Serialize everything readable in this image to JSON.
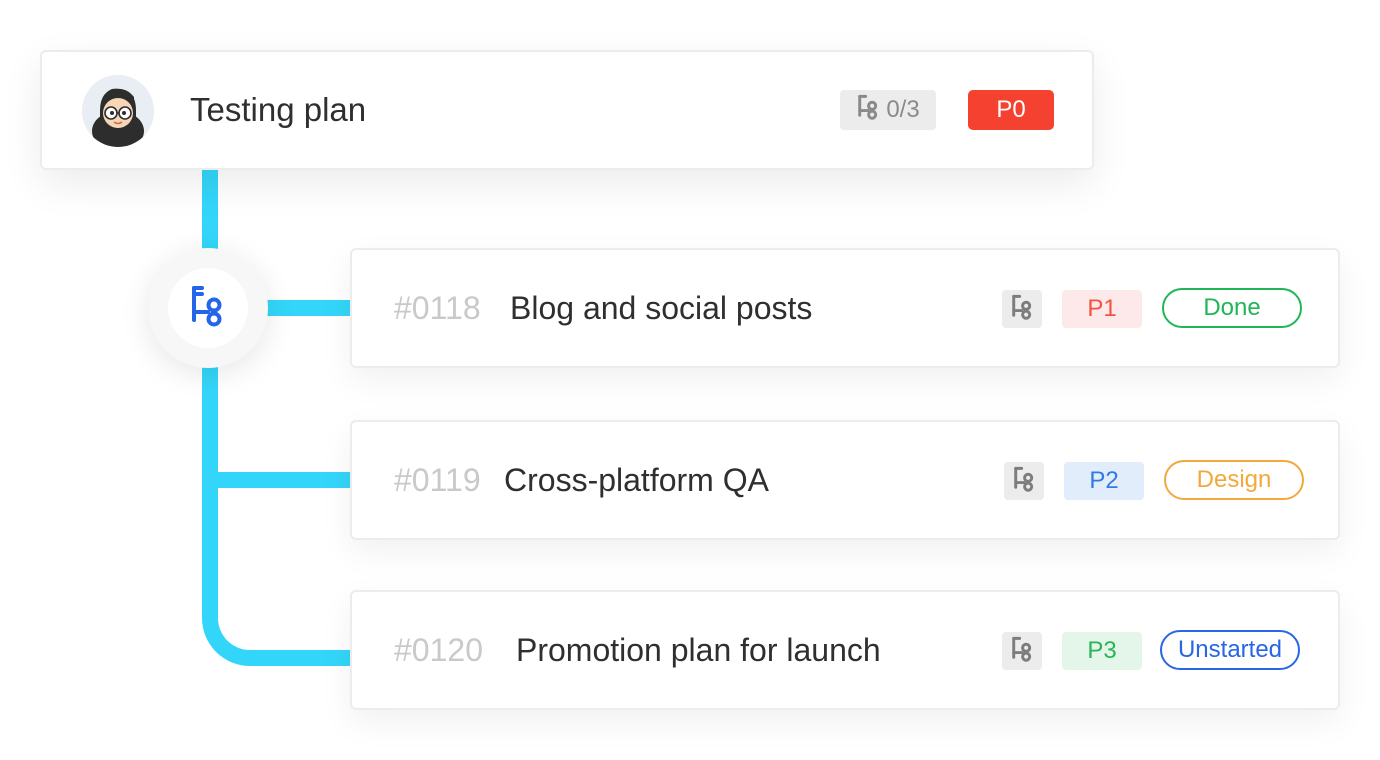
{
  "parent": {
    "title": "Testing plan",
    "subtask_count": "0/3",
    "priority": "P0"
  },
  "children": [
    {
      "id": "#0118",
      "title": "Blog and social posts",
      "priority": "P1",
      "status": "Done"
    },
    {
      "id": "#0119",
      "title": "Cross-platform QA",
      "priority": "P2",
      "status": "Design"
    },
    {
      "id": "#0120",
      "title": "Promotion plan for launch",
      "priority": "P3",
      "status": "Unstarted"
    }
  ],
  "icons": {
    "avatar": "user-avatar-icon",
    "subtask": "subtask-tree-icon",
    "node": "subtask-tree-icon"
  },
  "colors": {
    "connector": "#33d6f9",
    "p0": "#f5412f",
    "p1_bg": "#fde9e9",
    "p1_text": "#f3533f",
    "p2_bg": "#e2edfc",
    "p2_text": "#2f7be3",
    "p3_bg": "#e3f6e9",
    "p3_text": "#2bb35a",
    "done": "#1fb657",
    "design": "#f2a93b",
    "unstarted": "#2766e4"
  }
}
